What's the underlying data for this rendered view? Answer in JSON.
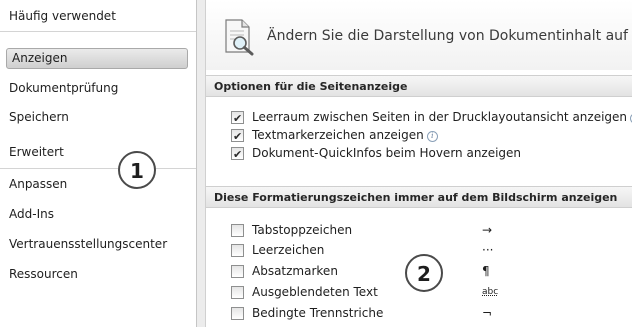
{
  "sidebar": {
    "items": [
      {
        "label": "Häufig verwendet"
      },
      {
        "label": "Anzeigen"
      },
      {
        "label": "Dokumentprüfung"
      },
      {
        "label": "Speichern"
      },
      {
        "label": "Erweitert"
      },
      {
        "label": "Anpassen"
      },
      {
        "label": "Add-Ins"
      },
      {
        "label": "Vertrauensstellungscenter"
      },
      {
        "label": "Ressourcen"
      }
    ],
    "selected": "Anzeigen"
  },
  "banner": {
    "icon": "document-magnifier-icon",
    "text": "Ändern Sie die Darstellung von Dokumentinhalt auf der"
  },
  "page_options": {
    "heading": "Optionen für die Seitenanzeige",
    "items": [
      {
        "label": "Leerraum zwischen Seiten in der Drucklayoutansicht anzeigen",
        "checked": true,
        "info": "ⓘ"
      },
      {
        "label": "Textmarkerzeichen anzeigen",
        "checked": true,
        "info": "ⓘ"
      },
      {
        "label": "Dokument-QuickInfos beim Hovern anzeigen",
        "checked": true
      }
    ]
  },
  "formatting_marks": {
    "heading": "Diese Formatierungszeichen immer auf dem Bildschirm anzeigen",
    "items": [
      {
        "label": "Tabstoppzeichen",
        "checked": false,
        "symbol": "→"
      },
      {
        "label": "Leerzeichen",
        "checked": false,
        "symbol": "···"
      },
      {
        "label": "Absatzmarken",
        "checked": false,
        "symbol": "¶"
      },
      {
        "label": "Ausgeblendeten Text",
        "checked": false,
        "symbol": "abc"
      },
      {
        "label": "Bedingte Trennstriche",
        "checked": false,
        "symbol": "¬"
      }
    ]
  },
  "callouts": [
    "1",
    "2"
  ]
}
